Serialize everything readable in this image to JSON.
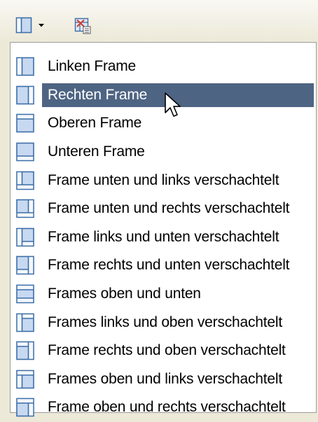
{
  "toolbar": {
    "frames_button_icon": "frame-layout-icon",
    "dropdown_icon": "chevron-down-icon",
    "secondary_icon": "frame-properties-icon"
  },
  "menu": {
    "items": [
      {
        "label": "Linken Frame",
        "icon": "frame-left-icon"
      },
      {
        "label": "Rechten Frame",
        "icon": "frame-right-icon",
        "highlighted": true
      },
      {
        "label": "Oberen Frame",
        "icon": "frame-top-icon"
      },
      {
        "label": "Unteren Frame",
        "icon": "frame-bottom-icon"
      },
      {
        "label": "Frame unten und links verschachtelt",
        "icon": "frame-bottom-left-nested-icon"
      },
      {
        "label": "Frame unten und rechts verschachtelt",
        "icon": "frame-bottom-right-nested-icon"
      },
      {
        "label": "Frame links und unten verschachtelt",
        "icon": "frame-left-bottom-nested-icon"
      },
      {
        "label": "Frame rechts und unten verschachtelt",
        "icon": "frame-right-bottom-nested-icon"
      },
      {
        "label": "Frames oben und unten",
        "icon": "frames-top-bottom-icon"
      },
      {
        "label": "Frames links und oben verschachtelt",
        "icon": "frames-left-top-nested-icon"
      },
      {
        "label": "Frame rechts und oben verschachtelt",
        "icon": "frame-right-top-nested-icon"
      },
      {
        "label": "Frames oben und links verschachtelt",
        "icon": "frames-top-left-nested-icon"
      },
      {
        "label": "Frame oben und rechts verschachtelt",
        "icon": "frame-top-right-nested-icon"
      }
    ]
  },
  "colors": {
    "toolbar_bg": "#ece9d8",
    "menu_bg": "#ffffff",
    "highlight_bg": "#4e6483",
    "icon_border": "#3c6ea8",
    "icon_fill": "#c7d9f1",
    "icon_frame_fill": "#f4f7fb"
  }
}
